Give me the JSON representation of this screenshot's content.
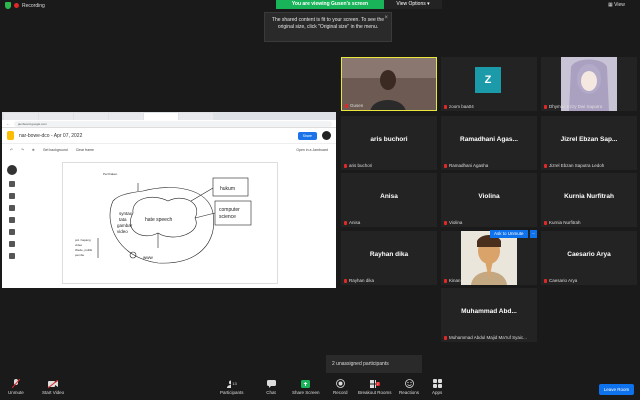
{
  "topbar": {
    "recording_label": "Recording",
    "viewing_banner": "You are viewing Gusen's screen",
    "view_options_label": "View Options",
    "view_label": "View",
    "tooltip_text": "The shared content is fit to your screen. To see the original size, click \"Original size\" in the menu."
  },
  "shared_screen": {
    "tabs": [
      "",
      "",
      "",
      "",
      "",
      ""
    ],
    "url": "jamboard.google.com",
    "doc_title": "nar-bowe-dco - Apr 07, 2022",
    "share_label": "Share",
    "toolbar": {
      "set_background": "Get background",
      "clear_frame": "Clear frame",
      "open_jamboard": "Open in a Jamboard"
    },
    "canvas": {
      "note_top": "Perzhaken",
      "word_hukum": "hukum",
      "word_computer": "computer",
      "word_science": "science",
      "word_hate": "hate speech",
      "word_syntax": "syntax",
      "word_tata": "tata",
      "word_gambar": "gambar",
      "word_video": "video",
      "word_www": "www",
      "word_left1": "pol. hapang",
      "word_left2": "video",
      "word_left3": "Wede, politik",
      "word_left4": "pembe"
    }
  },
  "participants_grid": [
    {
      "name": "",
      "label": "Gusen",
      "type": "video",
      "highlight": true
    },
    {
      "name": "",
      "label": "zoom baa04",
      "type": "avatar",
      "letter": "Z"
    },
    {
      "name": "",
      "label": "Dhymas Ezzy Dwi Saputra",
      "type": "anime"
    },
    {
      "name": "aris buchori",
      "label": "aris buchori",
      "type": "name"
    },
    {
      "name": "Ramadhani Agas...",
      "label": "Ramadhani Agasha",
      "type": "name"
    },
    {
      "name": "Jizrel Ebzan Sap...",
      "label": "Jizrel Ebzan Saputra Ledoh",
      "type": "name"
    },
    {
      "name": "Anisa",
      "label": "Anisa",
      "type": "name"
    },
    {
      "name": "Violina",
      "label": "Violina",
      "type": "name"
    },
    {
      "name": "Kurnia Nurfitrah",
      "label": "Kurnia Nurfitrah",
      "type": "name"
    },
    {
      "name": "Rayhan dika",
      "label": "Rayhan dika",
      "type": "name"
    },
    {
      "name": "",
      "label": "Kinan",
      "type": "memoji"
    },
    {
      "name": "Caesario Arya",
      "label": "Caesario Arya",
      "type": "name"
    },
    {
      "name": "Muhammad Abd...",
      "label": "Muhammad Abdul Majid Ma'ruf Syaic...",
      "type": "name"
    }
  ],
  "ask_to_unmute": "Ask to Unmute",
  "more_dots": "...",
  "unassigned": "2 unassigned participants",
  "toolbar": {
    "unmute": "Unmute",
    "start_video": "Start Video",
    "participants": "Participants",
    "participants_count": "13",
    "chat": "Chat",
    "share_screen": "Share Screen",
    "record": "Record",
    "breakout_rooms": "Breakout Rooms",
    "breakout_badge": "2",
    "reactions": "Reactions",
    "apps": "Apps",
    "leave": "Leave Room"
  },
  "colors": {
    "banner_green": "#19b35a",
    "zoom_blue": "#0e72ed",
    "muted_red": "#e02828",
    "tile_bg": "#232323",
    "avatar_teal": "#1b9aaa"
  }
}
